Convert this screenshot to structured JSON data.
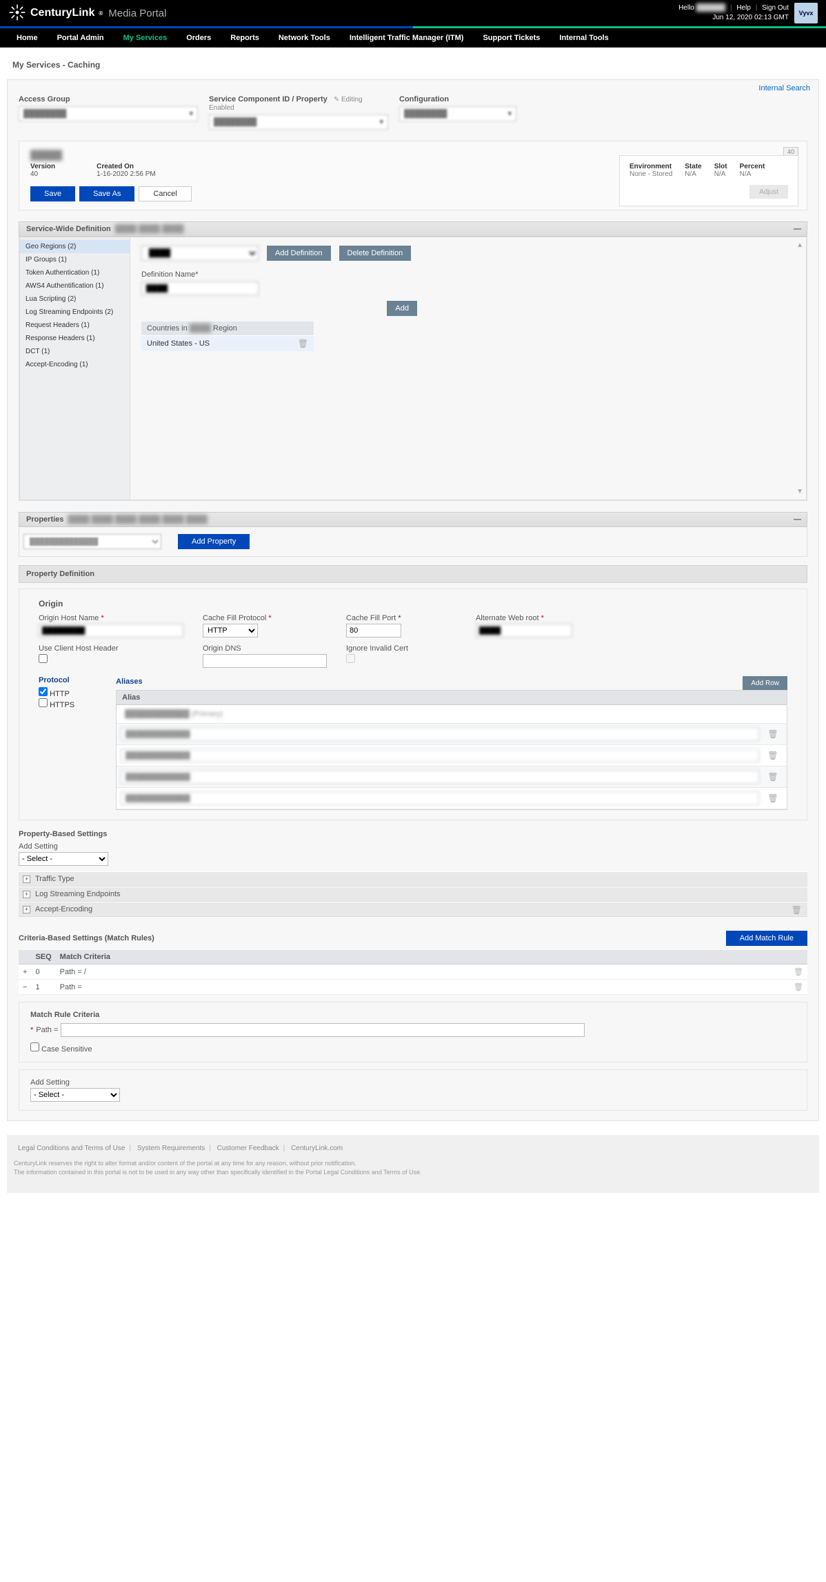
{
  "header": {
    "brand": "CenturyLink",
    "brand_reg": "®",
    "portal": "Media Portal",
    "hello": "Hello",
    "help": "Help",
    "sign_out": "Sign Out",
    "timestamp": "Jun 12, 2020 02:13 GMT"
  },
  "nav": {
    "home": "Home",
    "portal_admin": "Portal Admin",
    "my_services": "My Services",
    "orders": "Orders",
    "reports": "Reports",
    "network_tools": "Network Tools",
    "itm": "Intelligent Traffic Manager (ITM)",
    "support_tickets": "Support Tickets",
    "internal_tools": "Internal Tools"
  },
  "page": {
    "title": "My Services - Caching",
    "internal_search": "Internal Search"
  },
  "selectors": {
    "access_group_label": "Access Group",
    "access_group_value": "████████",
    "scid_label": "Service Component ID / Property",
    "editing_enabled": "Editing Enabled",
    "scid_value": "████████",
    "configuration_label": "Configuration",
    "configuration_value": "████████"
  },
  "config": {
    "name": "█████",
    "version_label": "Version",
    "version_value": "40",
    "created_label": "Created On",
    "created_value": "1-16-2020 2:56 PM",
    "save": "Save",
    "save_as": "Save As",
    "cancel": "Cancel",
    "vers_badge": "40",
    "env": {
      "env_label": "Environment",
      "env_value": "None - Stored",
      "state_label": "State",
      "state_value": "N/A",
      "slot_label": "Slot",
      "slot_value": "N/A",
      "percent_label": "Percent",
      "percent_value": "N/A",
      "adjust": "Adjust"
    }
  },
  "swd": {
    "title": "Service-Wide Definition",
    "sidebar": [
      "Geo Regions (2)",
      "IP Groups (1)",
      "Token Authentication (1)",
      "AWS4 Authentification (1)",
      "Lua Scripting (2)",
      "Log Streaming Endpoints (2)",
      "Request Headers (1)",
      "Response Headers (1)",
      "DCT (1)",
      "Accept-Encoding (1)"
    ],
    "add_def": "Add Definition",
    "delete_def": "Delete Definition",
    "def_name_label": "Definition Name*",
    "def_name_value": "████",
    "add_btn": "Add",
    "countries_label_pre": "Countries in",
    "countries_label_post": "Region",
    "country_row": "United States - US"
  },
  "properties": {
    "title": "Properties",
    "add_property": "Add Property",
    "prop_def_title": "Property Definition",
    "origin_title": "Origin",
    "origin_host_label": "Origin Host Name",
    "origin_host_value": "████████",
    "cache_fill_proto_label": "Cache Fill Protocol",
    "cache_fill_proto_value": "HTTP",
    "cache_fill_port_label": "Cache Fill Port",
    "cache_fill_port_value": "80",
    "alt_webroot_label": "Alternate Web root",
    "alt_webroot_value": "████",
    "use_client_host_label": "Use Client Host Header",
    "origin_dns_label": "Origin DNS",
    "ignore_cert_label": "Ignore Invalid Cert",
    "protocol_label": "Protocol",
    "http": "HTTP",
    "https": "HTTPS",
    "aliases_label": "Aliases",
    "add_row": "Add Row",
    "alias_header": "Alias",
    "aliases": [
      "████████████ (Primary)",
      "████████████",
      "████████████",
      "████████████",
      "████████████"
    ]
  },
  "pbs": {
    "title": "Property-Based Settings",
    "add_setting_label": "Add Setting",
    "add_setting_value": "- Select -",
    "rows": [
      "Traffic Type",
      "Log Streaming Endpoints",
      "Accept-Encoding"
    ]
  },
  "cbs": {
    "title": "Criteria-Based Settings (Match Rules)",
    "add_match_rule": "Add Match Rule",
    "seq_hdr": "SEQ",
    "criteria_hdr": "Match Criteria",
    "rows": [
      {
        "seq": "0",
        "criteria": "Path = /"
      },
      {
        "seq": "1",
        "criteria": "Path ="
      }
    ],
    "mrc_title": "Match Rule Criteria",
    "path_label": "Path =",
    "case_sensitive": "Case Sensitive",
    "add_setting_label": "Add Setting",
    "add_setting_value": "- Select -"
  },
  "footer": {
    "legal": "Legal Conditions and Terms of Use",
    "sysreq": "System Requirements",
    "feedback": "Customer Feedback",
    "clink": "CenturyLink.com",
    "line1": "CenturyLink reserves the right to alter format and/or content of the portal at any time for any reason, without prior notification.",
    "line2": "The information contained in this portal is not to be used in any way other than specifically identified in the Portal Legal Conditions and Terms of Use."
  }
}
